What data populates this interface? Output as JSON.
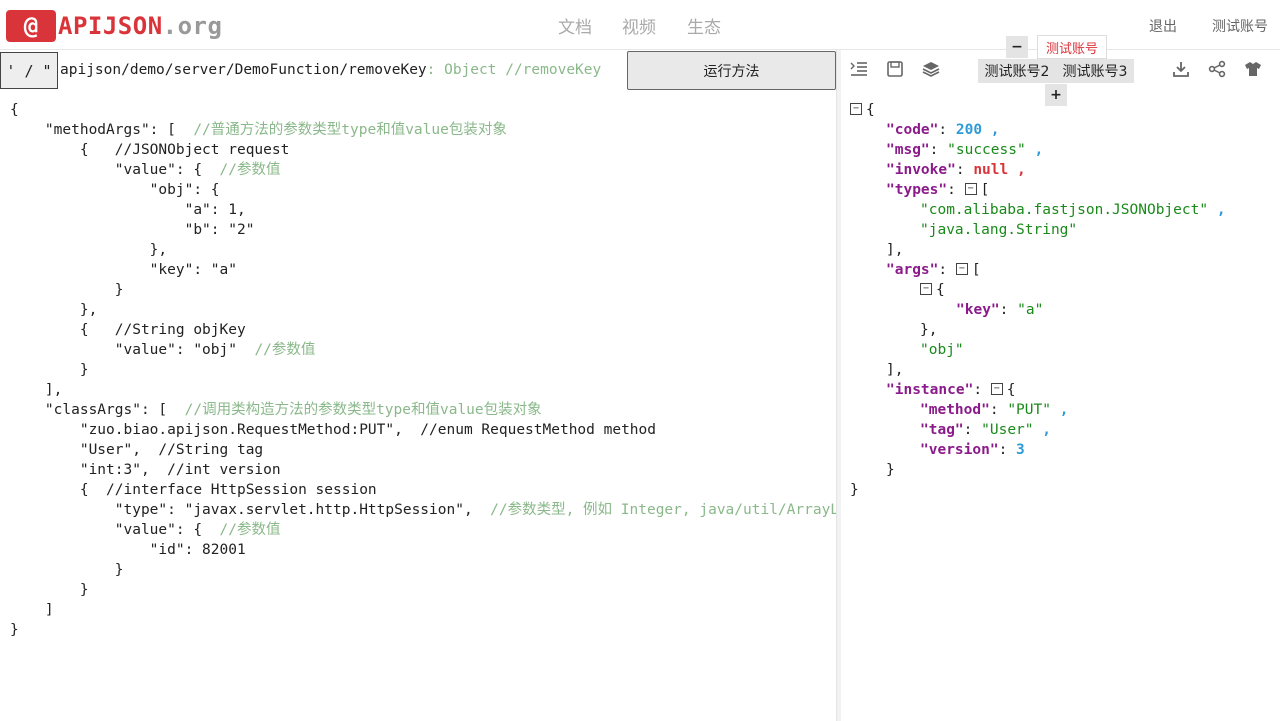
{
  "header": {
    "logo_symbol": "@",
    "logo_name": "APIJSON",
    "logo_suffix": ".org",
    "nav": [
      "文档",
      "视频",
      "生态"
    ],
    "logout": "退出",
    "account": "测试账号"
  },
  "request": {
    "method_button": "' / \"",
    "path": "apijson/demo/server/DemoFunction/removeKey",
    "type_hint": ": Object  //removeKey",
    "run_button": "运行方法"
  },
  "editor": {
    "lines": [
      {
        "code": "{",
        "comment": ""
      },
      {
        "code": "    \"methodArgs\": [  ",
        "comment": "//普通方法的参数类型type和值value包装对象"
      },
      {
        "code": "        {   //JSONObject request",
        "comment": ""
      },
      {
        "code": "            \"value\": {  ",
        "comment": "//参数值"
      },
      {
        "code": "                \"obj\": {",
        "comment": ""
      },
      {
        "code": "                    \"a\": 1,",
        "comment": ""
      },
      {
        "code": "                    \"b\": \"2\"",
        "comment": ""
      },
      {
        "code": "                },",
        "comment": ""
      },
      {
        "code": "                \"key\": \"a\"",
        "comment": ""
      },
      {
        "code": "            }",
        "comment": ""
      },
      {
        "code": "        },",
        "comment": ""
      },
      {
        "code": "        {   //String objKey",
        "comment": ""
      },
      {
        "code": "            \"value\": \"obj\"  ",
        "comment": "//参数值"
      },
      {
        "code": "        }",
        "comment": ""
      },
      {
        "code": "    ],",
        "comment": ""
      },
      {
        "code": "    \"classArgs\": [  ",
        "comment": "//调用类构造方法的参数类型type和值value包装对象"
      },
      {
        "code": "        \"zuo.biao.apijson.RequestMethod:PUT\",  //enum RequestMethod method",
        "comment": ""
      },
      {
        "code": "        \"User\",  //String tag",
        "comment": ""
      },
      {
        "code": "        \"int:3\",  //int version",
        "comment": ""
      },
      {
        "code": "        {  //interface HttpSession session",
        "comment": ""
      },
      {
        "code": "            \"type\": \"javax.servlet.http.HttpSession\",  ",
        "comment": "//参数类型, 例如 Integer, java/util/ArrayList"
      },
      {
        "code": "            \"value\": {  ",
        "comment": "//参数值"
      },
      {
        "code": "                \"id\": 82001",
        "comment": ""
      },
      {
        "code": "            }",
        "comment": ""
      },
      {
        "code": "        }",
        "comment": ""
      },
      {
        "code": "    ]",
        "comment": ""
      },
      {
        "code": "}",
        "comment": ""
      }
    ]
  },
  "toolbar": {
    "icons": [
      "list-indent-icon",
      "save-icon",
      "layers-icon",
      "download-icon",
      "share-icon",
      "shirt-icon"
    ],
    "current_account": "测试账号",
    "accounts": [
      "测试账号2",
      "测试账号3"
    ],
    "minus": "−",
    "plus": "+"
  },
  "response": {
    "code": "200",
    "msg": "\"success\"",
    "invoke": "null",
    "types": [
      "\"com.alibaba.fastjson.JSONObject\"",
      "\"java.lang.String\""
    ],
    "args_key": "\"a\"",
    "args_obj": "\"obj\"",
    "instance_method": "\"PUT\"",
    "instance_tag": "\"User\"",
    "instance_version": "3"
  }
}
